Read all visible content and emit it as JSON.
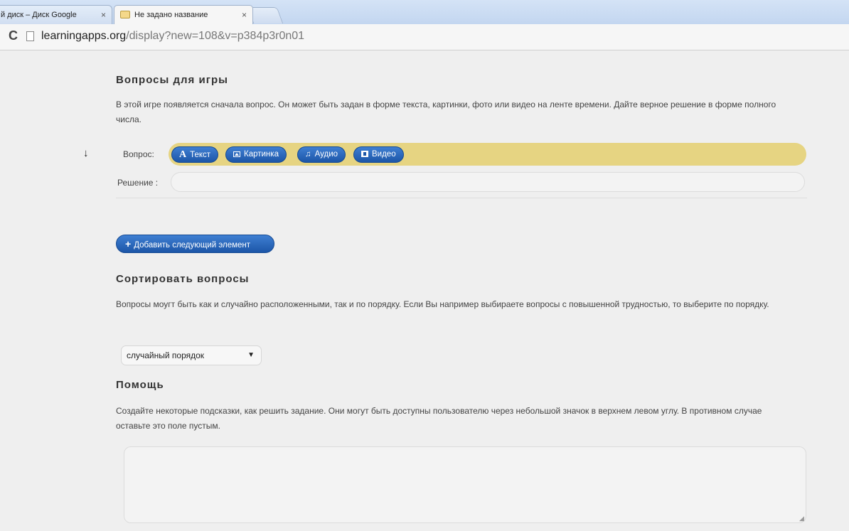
{
  "browser": {
    "tabs": [
      {
        "title": "й диск – Диск Google",
        "close": "×"
      },
      {
        "title": "Не задано название",
        "close": "×"
      }
    ],
    "url_host": "learningapps.org",
    "url_path": "/display?new=108&v=p384p3r0n01"
  },
  "questions": {
    "title": "Вопросы для игры",
    "description": "В этой игре появляется сначала вопрос. Он может быть задан в форме текста, картинки, фото или видео на ленте времени. Дайте верное решение в форме полного числа.",
    "question_label": "Вопрос:",
    "answer_label": "Решение :",
    "media_buttons": [
      "Текст",
      "Картинка",
      "Аудио",
      "Видео"
    ],
    "add_button": "Добавить следующий элемент"
  },
  "sorting": {
    "title": "Сортировать вопросы",
    "description": "Вопросы моугт быть как и случайно расположенными, так и по порядку. Если Вы например выбираете вопросы с повышенной трудностью, то выберите по порядку.",
    "selected_option": "случайный порядок"
  },
  "help": {
    "title": "Помощь",
    "description": "Создайте некоторые подсказки, как решить задание. Они могут быть доступны пользователю через небольшой значок в верхнем левом углу. В противном случае оставьте это поле пустым.",
    "value": ""
  },
  "colors": {
    "accent_blue": "#1c56a8",
    "question_bar": "#e6d482",
    "page_bg": "#efefef"
  }
}
